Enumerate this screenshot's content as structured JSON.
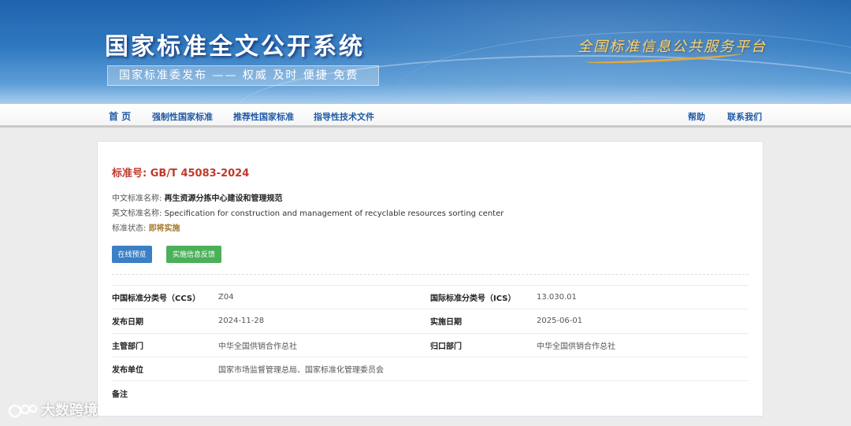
{
  "header": {
    "site_title": "国家标准全文公开系统",
    "slogan": "国家标准委发布 —— 权威 及时 便捷 免费",
    "platform": "全国标准信息公共服务平台"
  },
  "nav": {
    "home": "首 页",
    "mandatory": "强制性国家标准",
    "recommended": "推荐性国家标准",
    "guidance": "指导性技术文件",
    "help": "帮助",
    "contact": "联系我们"
  },
  "standard": {
    "number_label": "标准号: ",
    "number": "GB/T 45083-2024",
    "cn_name_label": "中文标准名称: ",
    "cn_name": "再生资源分拣中心建设和管理规范",
    "en_name_label": "英文标准名称: ",
    "en_name": "Specification for construction and management of recyclable resources sorting center",
    "status_label": "标准状态: ",
    "status": "即将实施"
  },
  "buttons": {
    "preview": "在线预览",
    "feedback": "实施信息反馈"
  },
  "meta": [
    {
      "k1": "中国标准分类号（CCS）",
      "v1": "Z04",
      "k2": "国际标准分类号（ICS）",
      "v2": "13.030.01"
    },
    {
      "k1": "发布日期",
      "v1": "2024-11-28",
      "k2": "实施日期",
      "v2": "2025-06-01"
    },
    {
      "k1": "主管部门",
      "v1": "中华全国供销合作总社",
      "k2": "归口部门",
      "v2": "中华全国供销合作总社"
    },
    {
      "k1": "发布单位",
      "v1": "国家市场监督管理总局、国家标准化管理委员会",
      "k2": "",
      "v2": ""
    },
    {
      "k1": "备注",
      "v1": "",
      "k2": "",
      "v2": ""
    }
  ],
  "watermark": "大数跨境",
  "colors": {
    "banner_blue": "#2f79c0",
    "nav_link": "#1f5aa6",
    "standard_number": "#c0392b",
    "status_text": "#a5782b",
    "preview_button": "#3b7fc4",
    "feedback_button": "#4cb05a",
    "platform_gold": "#ffd36a"
  }
}
